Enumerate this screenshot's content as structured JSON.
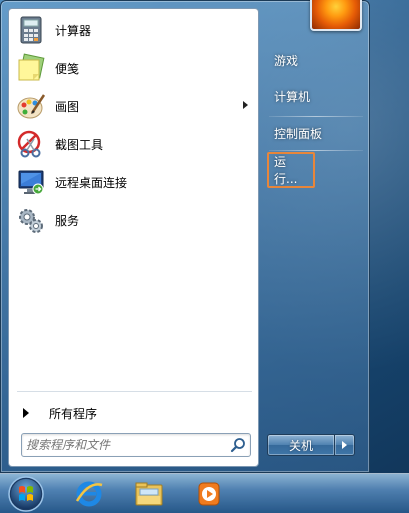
{
  "start_menu": {
    "programs": [
      {
        "label": "计算器",
        "icon": "calculator-icon"
      },
      {
        "label": "便笺",
        "icon": "sticky-notes-icon"
      },
      {
        "label": "画图",
        "icon": "paint-icon",
        "has_submenu": true
      },
      {
        "label": "截图工具",
        "icon": "snipping-tool-icon"
      },
      {
        "label": "远程桌面连接",
        "icon": "remote-desktop-icon"
      },
      {
        "label": "服务",
        "icon": "services-icon"
      }
    ],
    "all_programs_label": "所有程序",
    "search": {
      "placeholder": "搜索程序和文件",
      "value": ""
    },
    "right_items": {
      "games": "游戏",
      "computer": "计算机",
      "control_panel": "控制面板",
      "run": "运行..."
    },
    "shutdown_label": "关机"
  },
  "taskbar": {
    "items": [
      "start-orb-icon",
      "internet-explorer-icon",
      "windows-explorer-icon",
      "media-player-icon"
    ]
  },
  "colors": {
    "highlight_border": "#e8863a",
    "menu_left_bg": "#ffffff"
  }
}
